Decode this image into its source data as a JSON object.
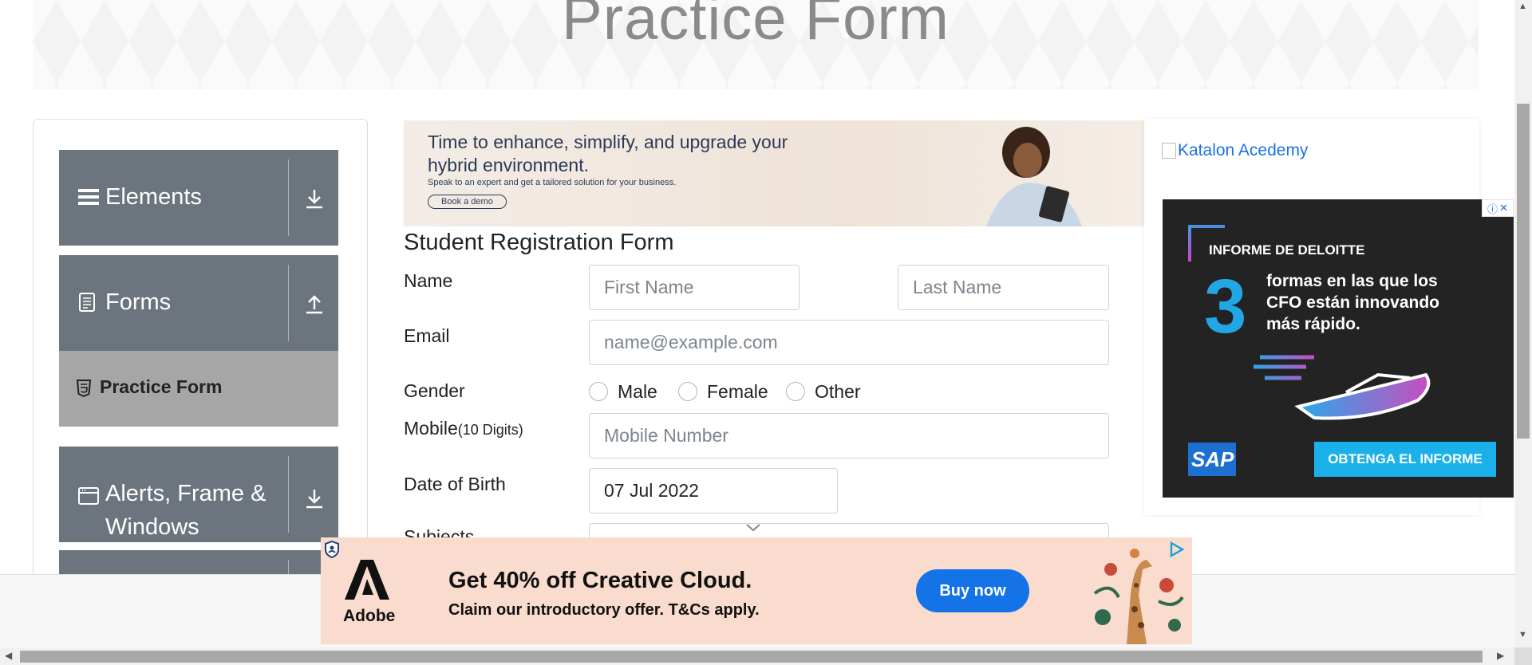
{
  "header": {
    "title": "Practice Form"
  },
  "sidebar": {
    "groups": [
      {
        "label": "Elements",
        "icon": "menu-icon",
        "toggle": "download-icon"
      },
      {
        "label": "Forms",
        "icon": "document-icon",
        "toggle": "upload-icon"
      },
      {
        "label": "Alerts, Frame &",
        "label2": "Windows",
        "icon": "window-icon",
        "toggle": "download-icon"
      }
    ],
    "active_item": {
      "label": "Practice Form",
      "icon": "html5-icon"
    }
  },
  "top_ad": {
    "line1": "Time to enhance, simplify, and upgrade your",
    "line1b": "hybrid environment.",
    "line2": "Speak to an expert and get a tailored solution for your business.",
    "button": "Book a demo"
  },
  "form": {
    "title": "Student Registration Form",
    "name_label": "Name",
    "first_name_placeholder": "First Name",
    "last_name_placeholder": "Last Name",
    "email_label": "Email",
    "email_placeholder": "name@example.com",
    "gender_label": "Gender",
    "genders": [
      "Male",
      "Female",
      "Other"
    ],
    "mobile_label": "Mobile",
    "mobile_hint": "(10 Digits)",
    "mobile_placeholder": "Mobile Number",
    "dob_label": "Date of Birth",
    "dob_value": "07 Jul 2022",
    "subjects_label": "Subjects"
  },
  "right_ad": {
    "katalon_alt": "Katalon Acedemy",
    "deloitte_head": "INFORME DE DELOITTE",
    "deloitte_number": "3",
    "deloitte_line1": "formas en las que los",
    "deloitte_line2": "CFO están innovando",
    "deloitte_line3": "más rápido.",
    "sap": "SAP",
    "cta": "OBTENGA EL INFORME"
  },
  "adobe_ad": {
    "brand": "Adobe",
    "headline": "Get 40% off Creative Cloud.",
    "sub": "Claim our introductory offer. T&Cs apply.",
    "button": "Buy now"
  }
}
